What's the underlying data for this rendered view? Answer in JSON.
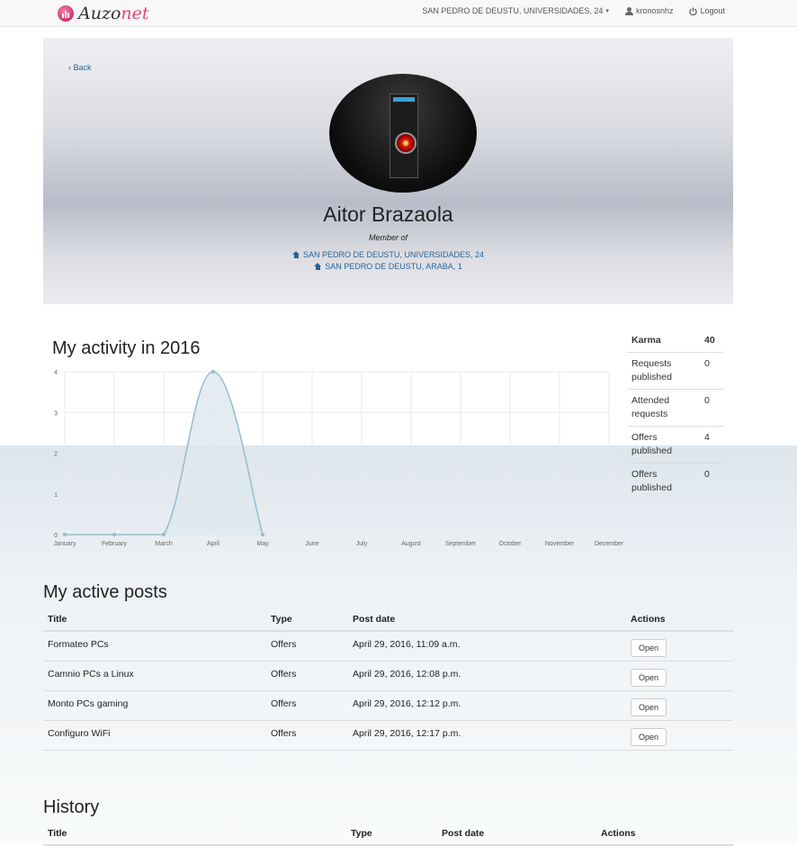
{
  "app": {
    "brand_a": "Auzo",
    "brand_b": "net"
  },
  "nav": {
    "community": "SAN PEDRO DE DEUSTU, UNIVERSIDADES, 24",
    "user": "kronosnhz",
    "logout": "Logout"
  },
  "profile": {
    "back": "Back",
    "name": "Aitor Brazaola",
    "member_of": "Member of",
    "communities": [
      "SAN PEDRO DE DEUSTU, UNIVERSIDADES, 24",
      "SAN PEDRO DE DEUSTU, ARABA, 1"
    ]
  },
  "activity": {
    "title": "My activity in 2016",
    "stats": [
      {
        "label": "Karma",
        "value": "40"
      },
      {
        "label": "Requests published",
        "value": "0"
      },
      {
        "label": "Attended requests",
        "value": "0"
      },
      {
        "label": "Offers published",
        "value": "4"
      },
      {
        "label": "Offers published",
        "value": "0"
      }
    ]
  },
  "chart_data": {
    "type": "area",
    "categories": [
      "January",
      "February",
      "March",
      "April",
      "May",
      "June",
      "July",
      "August",
      "September",
      "October",
      "November",
      "December"
    ],
    "values": [
      0,
      0,
      0,
      4,
      0
    ],
    "yticks": [
      "0",
      "1",
      "2",
      "3",
      "4"
    ],
    "ylim": [
      0,
      4
    ],
    "grid": true,
    "colors": {
      "line": "#97bbcd",
      "fill": "#dde7ef",
      "grid": "#eaeaea"
    }
  },
  "posts": {
    "title": "My active posts",
    "headers": [
      "Title",
      "Type",
      "Post date",
      "Actions"
    ],
    "rows": [
      {
        "title": "Formateo PCs",
        "type": "Offers",
        "date": "April 29, 2016, 11:09 a.m.",
        "action": "Open"
      },
      {
        "title": "Camnio PCs a Linux",
        "type": "Offers",
        "date": "April 29, 2016, 12:08 p.m.",
        "action": "Open"
      },
      {
        "title": "Monto PCs gaming",
        "type": "Offers",
        "date": "April 29, 2016, 12:12 p.m.",
        "action": "Open"
      },
      {
        "title": "Configuro WiFi",
        "type": "Offers",
        "date": "April 29, 2016, 12:17 p.m.",
        "action": "Open"
      }
    ]
  },
  "history": {
    "title": "History",
    "headers": [
      "Title",
      "Type",
      "Post date",
      "Actions"
    ]
  }
}
